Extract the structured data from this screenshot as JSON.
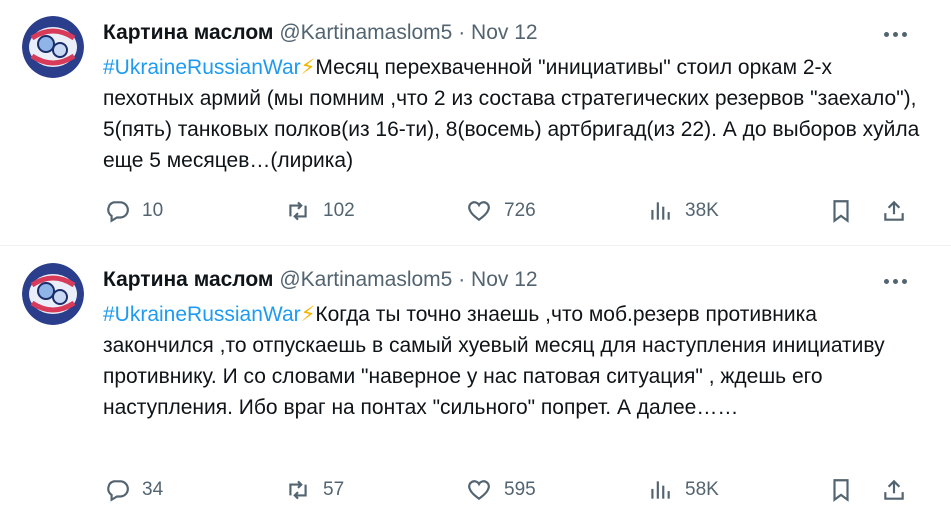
{
  "tweets": [
    {
      "name": "Картина маслом",
      "handle": "@Kartinamaslom5",
      "sep": "·",
      "date": "Nov 12",
      "hashtag": "#UkraineRussianWar",
      "bolt": "⚡",
      "text": "Месяц перехваченной \"инициативы\" стоил оркам 2-х пехотных армий (мы помним ,что 2 из состава стратегических резервов \"заехало\"), 5(пять) танковых полков(из 16-ти), 8(восемь) артбригад(из 22).  А до выборов хуйла еще 5 месяцев…(лирика)",
      "replies": "10",
      "retweets": "102",
      "likes": "726",
      "views": "38K"
    },
    {
      "name": "Картина маслом",
      "handle": "@Kartinamaslom5",
      "sep": "·",
      "date": "Nov 12",
      "hashtag": "#UkraineRussianWar",
      "bolt": "⚡",
      "text": "Когда ты точно знаешь ,что моб.резерв противника закончился ,то отпускаешь в самый хуевый месяц для наступления инициативу противнику. И со словами \"наверное у нас патовая ситуация\" , ждешь его наступления. Ибо враг на понтах \"сильного\" попрет. А далее……",
      "replies": "34",
      "retweets": "57",
      "likes": "595",
      "views": "58K"
    }
  ],
  "icons": {
    "reply": "reply-icon",
    "retweet": "retweet-icon",
    "like": "heart-icon",
    "views": "analytics-icon",
    "bookmark": "bookmark-icon",
    "share": "share-icon",
    "more": "more-icon"
  },
  "colors": {
    "link": "#1d9bf0",
    "muted": "#536471",
    "text": "#0f1419"
  }
}
